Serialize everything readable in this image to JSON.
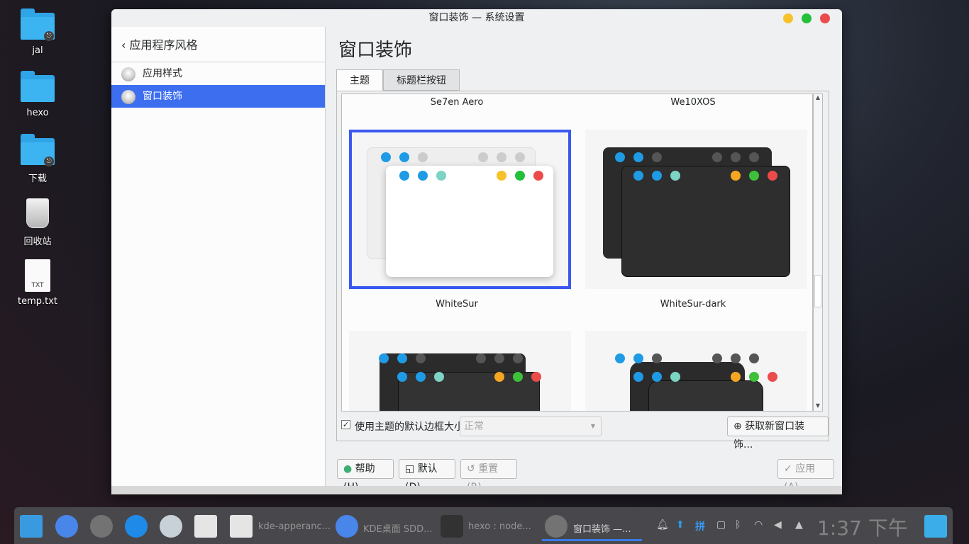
{
  "desktop": {
    "icons": [
      {
        "label": "jal"
      },
      {
        "label": "hexo"
      },
      {
        "label": "下载"
      },
      {
        "label": "回收站"
      },
      {
        "label": "temp.txt"
      }
    ],
    "txt_badge": "TXT"
  },
  "window": {
    "title": "窗口装饰 — 系统设置",
    "colors": {
      "min": "#f6c22c",
      "max": "#23c03a",
      "close": "#ec4b4b",
      "accent": "#3d6ef0"
    }
  },
  "sidebar": {
    "back_label": "应用程序风格",
    "items": [
      {
        "label": "应用样式"
      },
      {
        "label": "窗口装饰"
      }
    ]
  },
  "main": {
    "title": "窗口装饰",
    "tabs": [
      {
        "label": "主题"
      },
      {
        "label": "标题栏按钮"
      }
    ],
    "themes": [
      {
        "name": "Se7en Aero"
      },
      {
        "name": "We10XOS"
      },
      {
        "name": "WhiteSur"
      },
      {
        "name": "WhiteSur-dark"
      }
    ],
    "checkbox_label": "使用主题的默认边框大小",
    "border_size_value": "正常",
    "get_new_button": "获取新窗口装饰...",
    "help_button": "帮助(H)",
    "default_button": "默认(D)",
    "reset_button": "重置(R)",
    "apply_button": "应用(A)"
  },
  "taskbar": {
    "tasks": [
      {
        "label": "kde-apperanc..."
      },
      {
        "label": "KDE桌面 SDD..."
      },
      {
        "label": "hexo : node..."
      },
      {
        "label": "窗口装饰 —..."
      }
    ],
    "ime": "拼",
    "clock": "1:37 下午"
  }
}
